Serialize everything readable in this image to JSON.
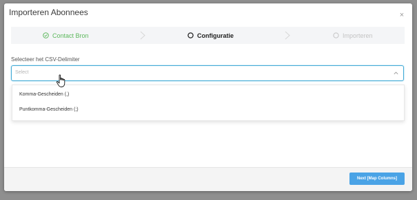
{
  "modal": {
    "title": "Importeren Abonnees",
    "close_glyph": "×"
  },
  "stepper": {
    "steps": [
      {
        "label": "Contact Bron",
        "state": "done",
        "icon": "check-circle-icon"
      },
      {
        "label": "Configuratie",
        "state": "active",
        "icon": "circle-outline-icon"
      },
      {
        "label": "Importeren",
        "state": "pending",
        "icon": "circle-outline-icon"
      }
    ]
  },
  "form": {
    "delimiter_label": "Selecteer het CSV-Delimiter",
    "delimiter_placeholder": "Select",
    "delimiter_options": [
      "Komma-Gescheiden (,)",
      "Puntkomma-Gescheiden (;)"
    ]
  },
  "footer": {
    "next_label": "Next [Map Columns]"
  },
  "colors": {
    "accent": "#4aa3e6",
    "success": "#5cb85c",
    "focus_border": "#3fa9d6",
    "pending": "#c3c3c3"
  }
}
